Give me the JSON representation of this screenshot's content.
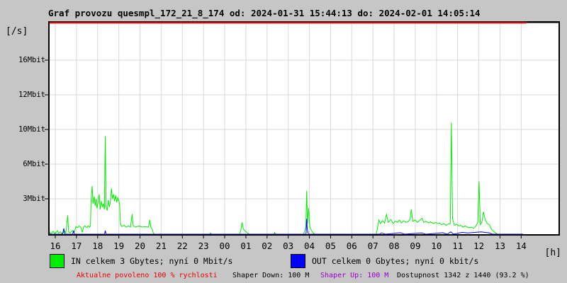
{
  "title": "Graf provozu quesmpl_172_21_8_174 od: 2024-01-31 15:44:13 do: 2024-02-01 14:05:14",
  "y_axis": {
    "unit_label": "[/s]",
    "ticks": [
      {
        "label": "16Mbit",
        "value": 16
      },
      {
        "label": "12Mbit",
        "value": 12
      },
      {
        "label": "10Mbit",
        "value": 10
      },
      {
        "label": "6Mbit",
        "value": 6
      },
      {
        "label": "3Mbit",
        "value": 3
      }
    ]
  },
  "x_axis": {
    "unit_label": "[h]",
    "hour_labels": [
      "16",
      "17",
      "18",
      "19",
      "20",
      "21",
      "22",
      "23",
      "00",
      "01",
      "02",
      "03",
      "04",
      "05",
      "06",
      "07",
      "08",
      "09",
      "10",
      "11",
      "12",
      "13",
      "14"
    ]
  },
  "legend": {
    "in": {
      "label": "IN celkem 3 Gbytes; nyní 0 Mbit/s",
      "color": "#00ee00"
    },
    "out": {
      "label": "OUT celkem 0 Gbytes; nyní 0 kbit/s",
      "color": "#0000ff"
    }
  },
  "status": {
    "allowed": {
      "text": "Aktualne povoleno 100 % rychlosti",
      "color": "#ee0000"
    },
    "shaper_down": {
      "text": "Shaper Down: 100 M",
      "color": "#000000"
    },
    "shaper_up": {
      "text": "Shaper Up: 100 M",
      "color": "#9900cc"
    },
    "availability": {
      "text": "Dostupnost 1342 z 1440 (93.2 %)",
      "color": "#000000"
    }
  },
  "chart_data": {
    "type": "line",
    "title": "Graf provozu quesmpl_172_21_8_174 od: 2024-01-31 15:44:13 do: 2024-02-01 14:05:14",
    "xlabel": "[h]",
    "ylabel": "[/s]",
    "x_unit": "hours since 16:00 of 2024-01-31",
    "x_range": [
      -0.3,
      22.15
    ],
    "y_tick_values": [
      3,
      6,
      10,
      12,
      16
    ],
    "grid": true,
    "legend_position": "bottom",
    "limit_line": {
      "label": "Aktualne povoleno 100 % rychlosti",
      "color": "#ff0000",
      "t_start": -0.33,
      "t_end": 22.25,
      "position": "top-of-scale"
    },
    "series": [
      {
        "name": "IN",
        "color": "#00ee00",
        "unit": "Mbit/s",
        "points": [
          [
            -0.3,
            0.0
          ],
          [
            -0.28,
            0.3
          ],
          [
            -0.25,
            0.1
          ],
          [
            -0.2,
            0.05
          ],
          [
            -0.1,
            0.25
          ],
          [
            -0.05,
            0.1
          ],
          [
            0.0,
            0.05
          ],
          [
            0.1,
            0.3
          ],
          [
            0.15,
            0.1
          ],
          [
            0.25,
            0.2
          ],
          [
            0.3,
            0.05
          ],
          [
            0.45,
            0.25
          ],
          [
            0.5,
            0.1
          ],
          [
            0.59,
            1.6
          ],
          [
            0.63,
            0.2
          ],
          [
            0.7,
            0.1
          ],
          [
            0.8,
            0.3
          ],
          [
            0.9,
            0.2
          ],
          [
            0.98,
            0.65
          ],
          [
            1.05,
            0.55
          ],
          [
            1.12,
            0.7
          ],
          [
            1.2,
            0.6
          ],
          [
            1.28,
            0.15
          ],
          [
            1.33,
            0.6
          ],
          [
            1.4,
            0.7
          ],
          [
            1.48,
            0.55
          ],
          [
            1.55,
            0.7
          ],
          [
            1.62,
            0.6
          ],
          [
            1.66,
            0.7
          ],
          [
            1.69,
            2.9
          ],
          [
            1.74,
            4.1
          ],
          [
            1.78,
            2.6
          ],
          [
            1.84,
            3.2
          ],
          [
            1.88,
            2.4
          ],
          [
            1.93,
            3.0
          ],
          [
            1.97,
            2.2
          ],
          [
            2.02,
            2.7
          ],
          [
            2.07,
            3.4
          ],
          [
            2.12,
            2.1
          ],
          [
            2.17,
            2.8
          ],
          [
            2.22,
            2.3
          ],
          [
            2.27,
            2.6
          ],
          [
            2.32,
            2.1
          ],
          [
            2.36,
            9.2
          ],
          [
            2.4,
            2.3
          ],
          [
            2.45,
            2.0
          ],
          [
            2.5,
            2.9
          ],
          [
            2.55,
            2.3
          ],
          [
            2.6,
            2.7
          ],
          [
            2.65,
            3.9
          ],
          [
            2.7,
            3.0
          ],
          [
            2.75,
            3.4
          ],
          [
            2.8,
            2.8
          ],
          [
            2.85,
            3.3
          ],
          [
            2.9,
            2.7
          ],
          [
            2.95,
            3.1
          ],
          [
            3.0,
            2.9
          ],
          [
            3.04,
            2.5
          ],
          [
            3.08,
            0.8
          ],
          [
            3.15,
            0.65
          ],
          [
            3.25,
            0.75
          ],
          [
            3.35,
            0.6
          ],
          [
            3.45,
            0.7
          ],
          [
            3.55,
            0.6
          ],
          [
            3.63,
            1.7
          ],
          [
            3.68,
            0.7
          ],
          [
            3.8,
            0.6
          ],
          [
            3.95,
            0.7
          ],
          [
            4.1,
            0.6
          ],
          [
            4.25,
            0.65
          ],
          [
            4.4,
            0.6
          ],
          [
            4.46,
            1.2
          ],
          [
            4.52,
            0.55
          ],
          [
            4.58,
            0.4
          ],
          [
            4.63,
            0.1
          ],
          [
            4.68,
            0.0
          ],
          [
            7.3,
            0.0
          ],
          [
            7.33,
            0.1
          ],
          [
            7.38,
            0.0
          ],
          [
            8.7,
            0.0
          ],
          [
            8.76,
            0.3
          ],
          [
            8.82,
            1.0
          ],
          [
            8.88,
            0.45
          ],
          [
            8.95,
            0.3
          ],
          [
            9.05,
            0.15
          ],
          [
            9.15,
            0.0
          ],
          [
            10.32,
            0.0
          ],
          [
            10.36,
            0.15
          ],
          [
            10.4,
            0.0
          ],
          [
            11.72,
            0.0
          ],
          [
            11.78,
            0.3
          ],
          [
            11.83,
            0.6
          ],
          [
            11.87,
            3.7
          ],
          [
            11.91,
            0.9
          ],
          [
            11.96,
            2.2
          ],
          [
            12.02,
            0.6
          ],
          [
            12.1,
            0.3
          ],
          [
            12.18,
            0.1
          ],
          [
            12.25,
            0.0
          ],
          [
            15.15,
            0.0
          ],
          [
            15.2,
            0.4
          ],
          [
            15.28,
            1.2
          ],
          [
            15.35,
            0.9
          ],
          [
            15.45,
            1.15
          ],
          [
            15.55,
            0.95
          ],
          [
            15.64,
            1.7
          ],
          [
            15.72,
            1.0
          ],
          [
            15.85,
            1.25
          ],
          [
            15.95,
            0.9
          ],
          [
            16.05,
            1.1
          ],
          [
            16.15,
            1.0
          ],
          [
            16.25,
            1.2
          ],
          [
            16.35,
            0.95
          ],
          [
            16.45,
            1.15
          ],
          [
            16.55,
            1.0
          ],
          [
            16.65,
            1.05
          ],
          [
            16.75,
            1.25
          ],
          [
            16.81,
            2.1
          ],
          [
            16.88,
            1.1
          ],
          [
            17.0,
            1.2
          ],
          [
            17.1,
            1.0
          ],
          [
            17.2,
            1.15
          ],
          [
            17.32,
            1.35
          ],
          [
            17.4,
            1.0
          ],
          [
            17.5,
            1.1
          ],
          [
            17.62,
            0.95
          ],
          [
            17.72,
            1.05
          ],
          [
            17.85,
            0.9
          ],
          [
            17.95,
            1.0
          ],
          [
            18.05,
            0.9
          ],
          [
            18.15,
            0.95
          ],
          [
            18.25,
            0.8
          ],
          [
            18.35,
            0.9
          ],
          [
            18.45,
            0.75
          ],
          [
            18.55,
            0.85
          ],
          [
            18.65,
            0.9
          ],
          [
            18.7,
            10.4
          ],
          [
            18.76,
            1.3
          ],
          [
            18.85,
            0.75
          ],
          [
            18.95,
            0.85
          ],
          [
            19.05,
            0.7
          ],
          [
            19.15,
            0.75
          ],
          [
            19.25,
            0.6
          ],
          [
            19.35,
            0.7
          ],
          [
            19.45,
            0.6
          ],
          [
            19.55,
            0.55
          ],
          [
            19.65,
            0.6
          ],
          [
            19.75,
            0.5
          ],
          [
            19.85,
            0.65
          ],
          [
            19.95,
            1.0
          ],
          [
            20.01,
            4.5
          ],
          [
            20.07,
            0.8
          ],
          [
            20.14,
            1.0
          ],
          [
            20.22,
            1.9
          ],
          [
            20.3,
            1.2
          ],
          [
            20.4,
            0.9
          ],
          [
            20.5,
            0.8
          ],
          [
            20.6,
            0.4
          ],
          [
            20.7,
            0.25
          ],
          [
            20.8,
            0.1
          ],
          [
            20.88,
            0.0
          ],
          [
            22.08,
            0.0
          ]
        ]
      },
      {
        "name": "OUT",
        "color": "#0000ff",
        "unit": "Mbit/s",
        "points": [
          [
            -0.3,
            0.0
          ],
          [
            0.35,
            0.0
          ],
          [
            0.4,
            0.5
          ],
          [
            0.45,
            0.0
          ],
          [
            0.82,
            0.0
          ],
          [
            0.86,
            0.3
          ],
          [
            0.9,
            0.0
          ],
          [
            2.33,
            0.0
          ],
          [
            2.36,
            0.3
          ],
          [
            2.4,
            0.0
          ],
          [
            11.84,
            0.0
          ],
          [
            11.87,
            1.3
          ],
          [
            11.9,
            0.4
          ],
          [
            11.95,
            0.0
          ],
          [
            15.3,
            0.0
          ],
          [
            15.4,
            0.1
          ],
          [
            15.6,
            0.0
          ],
          [
            16.3,
            0.12
          ],
          [
            16.5,
            0.0
          ],
          [
            17.3,
            0.1
          ],
          [
            17.5,
            0.0
          ],
          [
            18.3,
            0.12
          ],
          [
            18.5,
            0.0
          ],
          [
            18.68,
            0.2
          ],
          [
            18.8,
            0.0
          ],
          [
            19.2,
            0.15
          ],
          [
            19.5,
            0.1
          ],
          [
            19.8,
            0.15
          ],
          [
            20.1,
            0.2
          ],
          [
            20.3,
            0.15
          ],
          [
            20.5,
            0.1
          ],
          [
            20.65,
            0.0
          ],
          [
            22.08,
            0.0
          ]
        ]
      }
    ]
  },
  "colors": {
    "background": "#c6c6c6",
    "plot_background": "#ffffff",
    "grid": "#d8d8d8",
    "axis": "#000000",
    "limit_line": "#ff0000"
  }
}
